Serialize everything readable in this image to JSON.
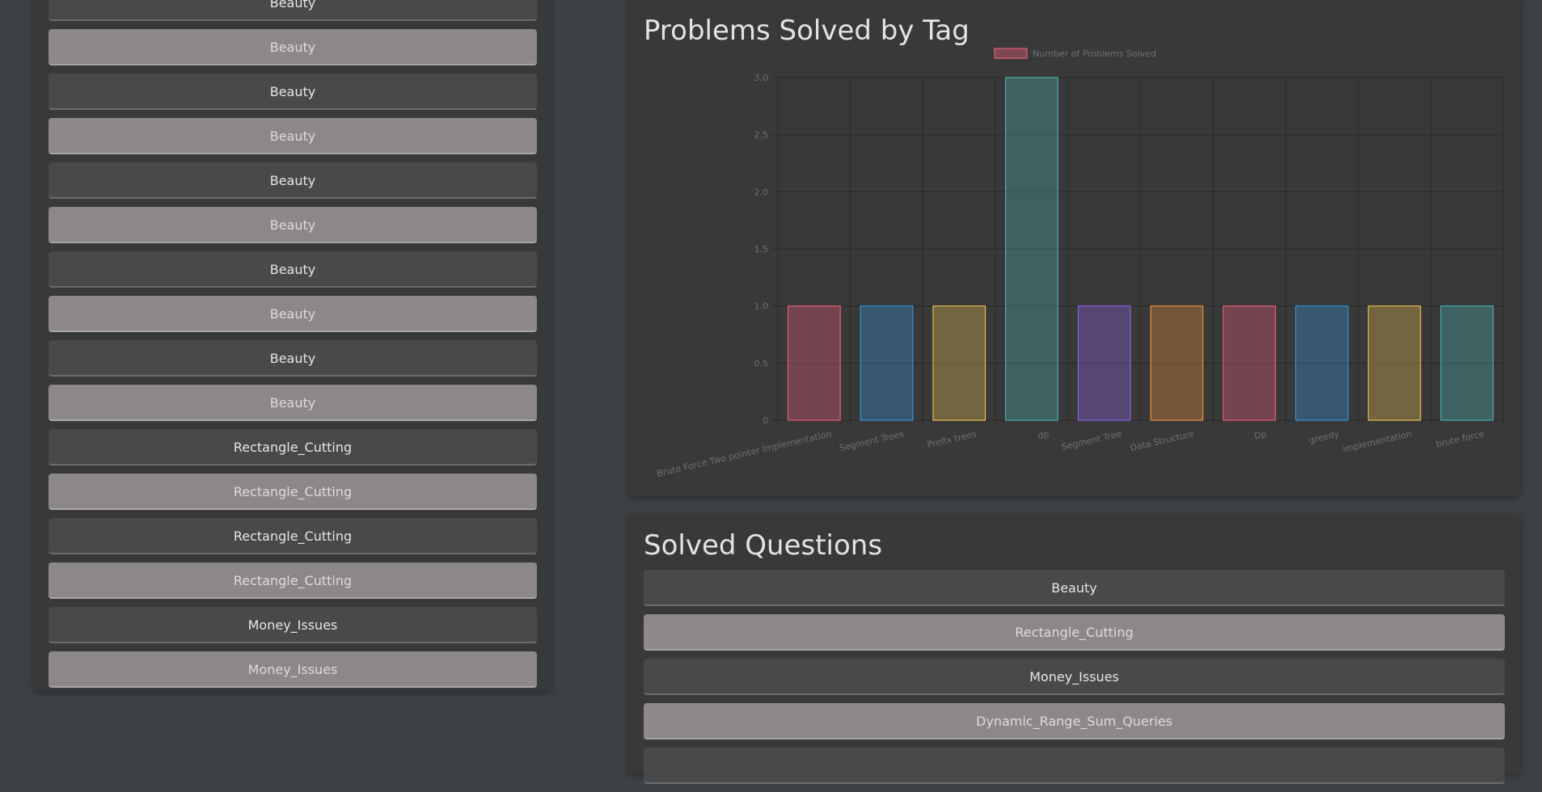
{
  "left_list": {
    "items": [
      {
        "label": "Beauty",
        "style": "dark"
      },
      {
        "label": "Beauty",
        "style": "light"
      },
      {
        "label": "Beauty",
        "style": "dark"
      },
      {
        "label": "Beauty",
        "style": "light"
      },
      {
        "label": "Beauty",
        "style": "dark"
      },
      {
        "label": "Beauty",
        "style": "light"
      },
      {
        "label": "Beauty",
        "style": "dark"
      },
      {
        "label": "Beauty",
        "style": "light"
      },
      {
        "label": "Beauty",
        "style": "dark"
      },
      {
        "label": "Beauty",
        "style": "light"
      },
      {
        "label": "Rectangle_Cutting",
        "style": "dark"
      },
      {
        "label": "Rectangle_Cutting",
        "style": "light"
      },
      {
        "label": "Rectangle_Cutting",
        "style": "dark"
      },
      {
        "label": "Rectangle_Cutting",
        "style": "light"
      },
      {
        "label": "Money_Issues",
        "style": "dark"
      },
      {
        "label": "Money_Issues",
        "style": "light"
      }
    ]
  },
  "chart_card": {
    "title": "Problems Solved by Tag"
  },
  "chart_data": {
    "type": "bar",
    "title": "",
    "xlabel": "",
    "ylabel": "",
    "categories": [
      "Brute Force Two pointer Implementation",
      "Segment Trees",
      "Prefix trees",
      "dp",
      "Segment Tree",
      "Data Structure",
      "Dp",
      "greedy",
      "implementation",
      "brute force"
    ],
    "series": [
      {
        "name": "Number of Problems Solved",
        "values": [
          1,
          1,
          1,
          3,
          1,
          1,
          1,
          1,
          1,
          1
        ]
      }
    ],
    "ylim": [
      0,
      3
    ],
    "yticks": [
      "0",
      "0.5",
      "1.0",
      "1.5",
      "2.0",
      "2.5",
      "3.0"
    ],
    "grid": true,
    "legend_position": "top",
    "legend_color": "#ff6384",
    "bar_colors": [
      "#ff6384",
      "#36a2eb",
      "#ffce56",
      "#4bc0c0",
      "#9966ff",
      "#ff9f40",
      "#ff6384",
      "#36a2eb",
      "#ffce56",
      "#4bc0c0"
    ]
  },
  "solved_card": {
    "title": "Solved Questions",
    "items": [
      {
        "label": "Beauty",
        "style": "dark"
      },
      {
        "label": "Rectangle_Cutting",
        "style": "light"
      },
      {
        "label": "Money_Issues",
        "style": "dark"
      },
      {
        "label": "Dynamic_Range_Sum_Queries",
        "style": "light"
      },
      {
        "label": "",
        "style": "dark"
      }
    ]
  }
}
